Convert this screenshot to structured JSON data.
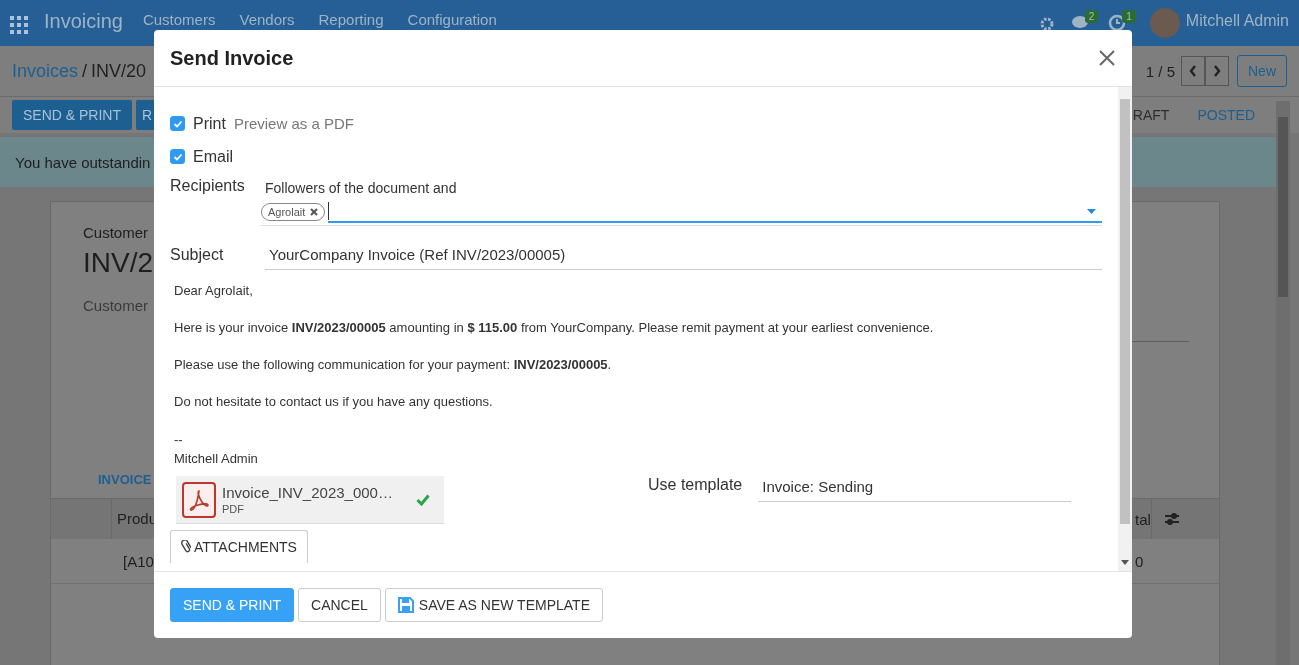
{
  "navbar": {
    "app_name": "Invoicing",
    "menu": [
      "Customers",
      "Vendors",
      "Reporting",
      "Configuration"
    ],
    "badges": [
      "2",
      "1"
    ],
    "user": "Mitchell Admin"
  },
  "control_panel": {
    "breadcrumb": [
      "Invoices",
      "INV/20"
    ],
    "breadcrumb_separator": "/",
    "pager": "1 / 5",
    "new_button": "New",
    "actions": [
      "SEND & PRINT",
      "R"
    ],
    "statuses": [
      {
        "label": "RAFT",
        "selected": false
      },
      {
        "label": "POSTED",
        "selected": true
      }
    ]
  },
  "alert": "You have outstandin",
  "form": {
    "type_label": "Customer",
    "name": "INV/2",
    "customer_label": "Customer",
    "tab": "INVOICE",
    "table": {
      "columns": [
        "Produ",
        "tal"
      ],
      "rows": [
        [
          "[A10",
          "0"
        ]
      ]
    }
  },
  "dialog": {
    "title": "Send Invoice",
    "options": [
      {
        "label": "Print",
        "hint": "Preview as a PDF",
        "checked": true
      },
      {
        "label": "Email",
        "checked": true
      }
    ],
    "recipients": {
      "label": "Recipients",
      "note": "Followers of the document and",
      "tags": [
        "Agrolait"
      ]
    },
    "subject": {
      "label": "Subject",
      "value": "YourCompany Invoice (Ref INV/2023/00005)"
    },
    "body": [
      "Dear Agrolait,",
      "Here is your invoice **INV/2023/00005** amounting in **$ 115.00** from YourCompany. Please remit payment at your earliest convenience.",
      "Please use the following communication for your payment: **INV/2023/00005**.",
      "Do not hesitate to contact us if you have any questions."
    ],
    "signature": [
      "--",
      "Mitchell Admin"
    ],
    "attachment": {
      "name": "Invoice_INV_2023_000…",
      "type": "PDF",
      "uploaded": true
    },
    "attachments_button": "ATTACHMENTS",
    "template": {
      "label": "Use template",
      "value": "Invoice: Sending"
    },
    "buttons": [
      {
        "label": "SEND & PRINT",
        "kind": "primary"
      },
      {
        "label": "CANCEL",
        "kind": "secondary"
      },
      {
        "label": "SAVE AS NEW TEMPLATE",
        "kind": "save"
      }
    ]
  }
}
